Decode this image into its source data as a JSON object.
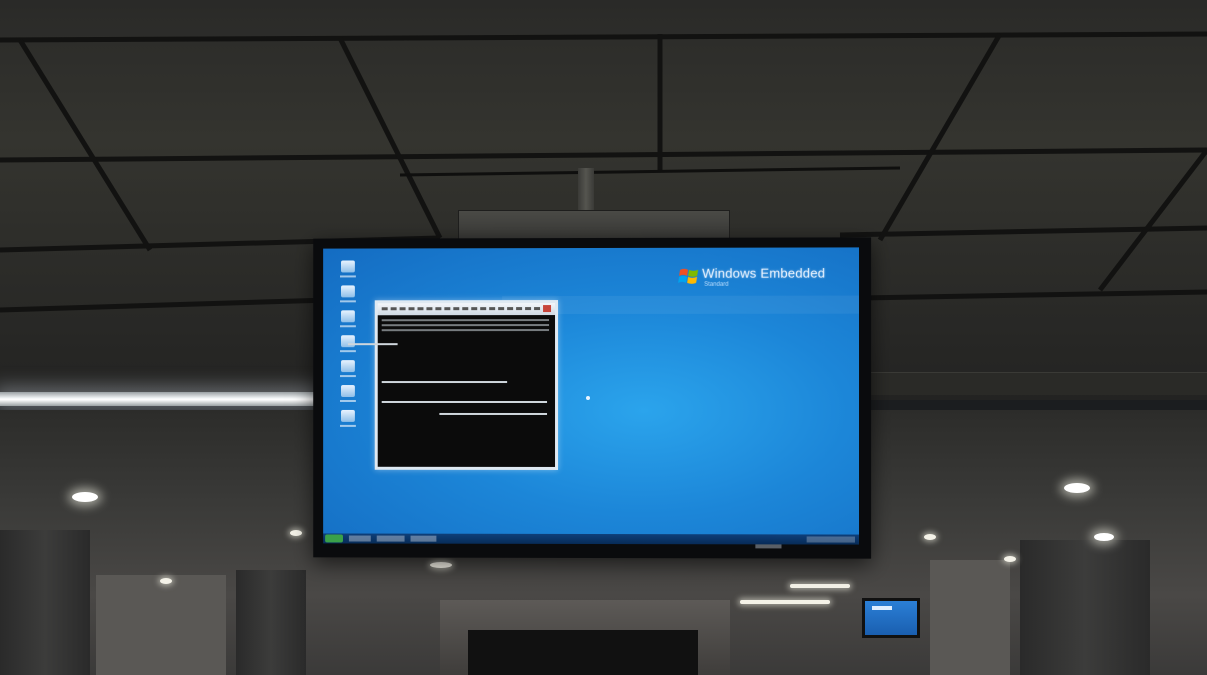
{
  "scene": {
    "description_type": "photo",
    "colors": {
      "desktop": "#1c86d8",
      "console_bg": "#0b0b0b",
      "ceiling": "#34342f",
      "taskbar": "#0e3f7a"
    }
  },
  "monitor": {
    "os_brand_title": "Windows Embedded",
    "os_brand_subtitle": "Standard",
    "logo": "windows-flag-icon",
    "desktop_icon_count": 7
  }
}
